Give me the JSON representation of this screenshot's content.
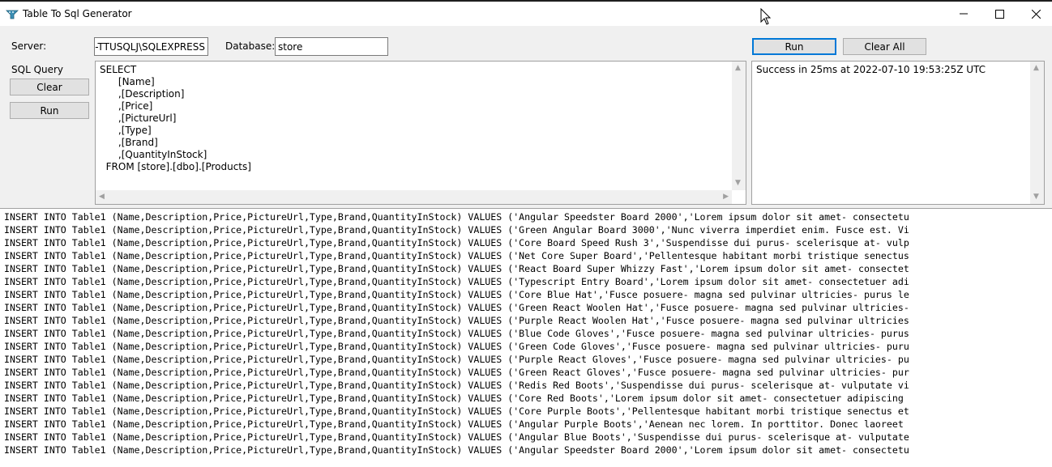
{
  "window": {
    "title": "Table To Sql Generator",
    "icon": "app-funnel-icon"
  },
  "connection": {
    "server_label": "Server:",
    "server_value": "DP-TTUSQLJ\\SQLEXPRESS",
    "database_label": "Database:",
    "database_value": "store"
  },
  "top_buttons": {
    "run_label": "Run",
    "clear_all_label": "Clear All"
  },
  "query": {
    "label": "SQL Query",
    "clear_label": "Clear",
    "run_label": "Run",
    "text": "SELECT\n      [Name]\n      ,[Description]\n      ,[Price]\n      ,[PictureUrl]\n      ,[Type]\n      ,[Brand]\n      ,[QuantityInStock]\n  FROM [store].[dbo].[Products]"
  },
  "result": {
    "text": "Success in 25ms at 2022-07-10 19:53:25Z UTC"
  },
  "output": {
    "lines": [
      "INSERT INTO Table1 (Name,Description,Price,PictureUrl,Type,Brand,QuantityInStock) VALUES ('Angular Speedster Board 2000','Lorem ipsum dolor sit amet- consectetu",
      "INSERT INTO Table1 (Name,Description,Price,PictureUrl,Type,Brand,QuantityInStock) VALUES ('Green Angular Board 3000','Nunc viverra imperdiet enim. Fusce est. Vi",
      "INSERT INTO Table1 (Name,Description,Price,PictureUrl,Type,Brand,QuantityInStock) VALUES ('Core Board Speed Rush 3','Suspendisse dui purus- scelerisque at- vulp",
      "INSERT INTO Table1 (Name,Description,Price,PictureUrl,Type,Brand,QuantityInStock) VALUES ('Net Core Super Board','Pellentesque habitant morbi tristique senectus",
      "INSERT INTO Table1 (Name,Description,Price,PictureUrl,Type,Brand,QuantityInStock) VALUES ('React Board Super Whizzy Fast','Lorem ipsum dolor sit amet- consectet",
      "INSERT INTO Table1 (Name,Description,Price,PictureUrl,Type,Brand,QuantityInStock) VALUES ('Typescript Entry Board','Lorem ipsum dolor sit amet- consectetuer adi",
      "INSERT INTO Table1 (Name,Description,Price,PictureUrl,Type,Brand,QuantityInStock) VALUES ('Core Blue Hat','Fusce posuere- magna sed pulvinar ultricies- purus le",
      "INSERT INTO Table1 (Name,Description,Price,PictureUrl,Type,Brand,QuantityInStock) VALUES ('Green React Woolen Hat','Fusce posuere- magna sed pulvinar ultricies-",
      "INSERT INTO Table1 (Name,Description,Price,PictureUrl,Type,Brand,QuantityInStock) VALUES ('Purple React Woolen Hat','Fusce posuere- magna sed pulvinar ultricies",
      "INSERT INTO Table1 (Name,Description,Price,PictureUrl,Type,Brand,QuantityInStock) VALUES ('Blue Code Gloves','Fusce posuere- magna sed pulvinar ultricies- purus",
      "INSERT INTO Table1 (Name,Description,Price,PictureUrl,Type,Brand,QuantityInStock) VALUES ('Green Code Gloves','Fusce posuere- magna sed pulvinar ultricies- puru",
      "INSERT INTO Table1 (Name,Description,Price,PictureUrl,Type,Brand,QuantityInStock) VALUES ('Purple React Gloves','Fusce posuere- magna sed pulvinar ultricies- pu",
      "INSERT INTO Table1 (Name,Description,Price,PictureUrl,Type,Brand,QuantityInStock) VALUES ('Green React Gloves','Fusce posuere- magna sed pulvinar ultricies- pur",
      "INSERT INTO Table1 (Name,Description,Price,PictureUrl,Type,Brand,QuantityInStock) VALUES ('Redis Red Boots','Suspendisse dui purus- scelerisque at- vulputate vi",
      "INSERT INTO Table1 (Name,Description,Price,PictureUrl,Type,Brand,QuantityInStock) VALUES ('Core Red Boots','Lorem ipsum dolor sit amet- consectetuer adipiscing",
      "INSERT INTO Table1 (Name,Description,Price,PictureUrl,Type,Brand,QuantityInStock) VALUES ('Core Purple Boots','Pellentesque habitant morbi tristique senectus et",
      "INSERT INTO Table1 (Name,Description,Price,PictureUrl,Type,Brand,QuantityInStock) VALUES ('Angular Purple Boots','Aenean nec lorem. In porttitor. Donec laoreet",
      "INSERT INTO Table1 (Name,Description,Price,PictureUrl,Type,Brand,QuantityInStock) VALUES ('Angular Blue Boots','Suspendisse dui purus- scelerisque at- vulputate",
      "INSERT INTO Table1 (Name,Description,Price,PictureUrl,Type,Brand,QuantityInStock) VALUES ('Angular Speedster Board 2000','Lorem ipsum dolor sit amet- consectetu"
    ]
  },
  "colors": {
    "accent": "#0078d7",
    "window_bg": "#f0f0f0",
    "control_bg": "#e1e1e1"
  }
}
